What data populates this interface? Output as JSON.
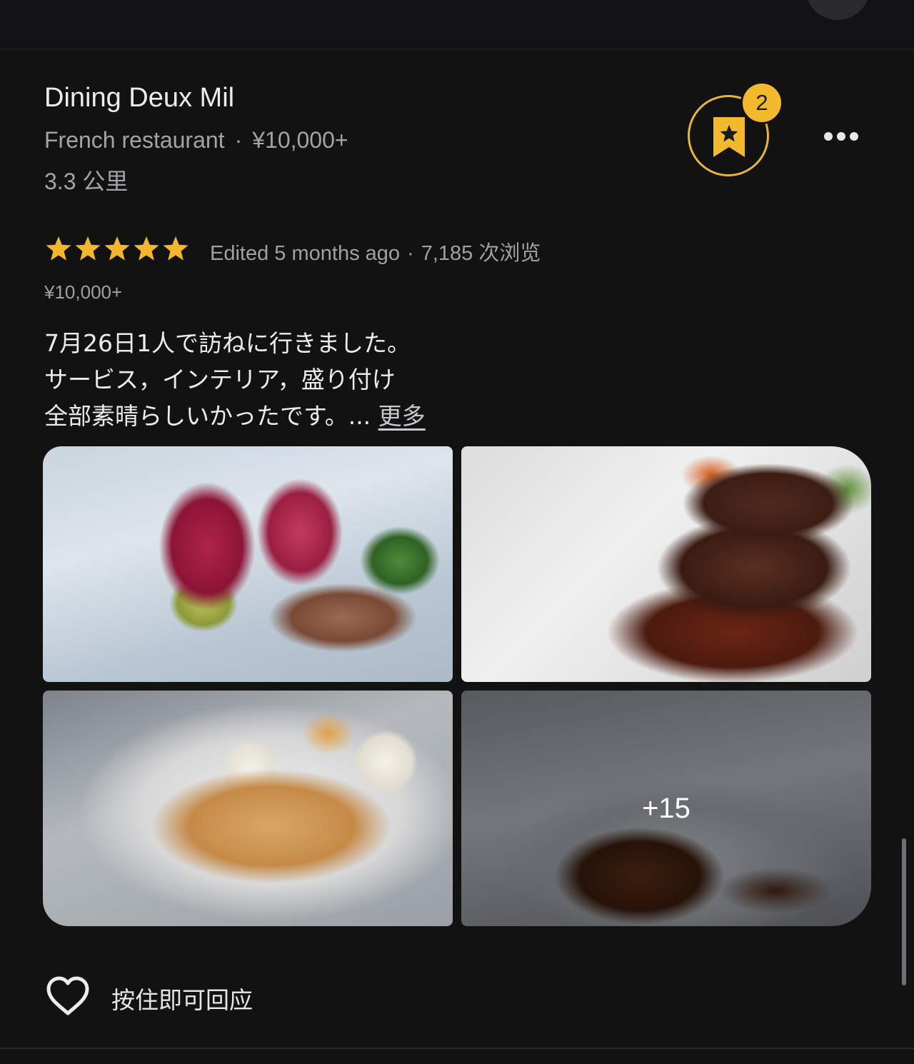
{
  "place": {
    "name": "Dining Deux Mil",
    "category": "French restaurant",
    "separator": "·",
    "price_range": "¥10,000+",
    "distance": "3.3 公里",
    "saved_count": "2"
  },
  "review": {
    "rating": 5,
    "edited": "Edited 5 months ago",
    "separator": "·",
    "views": "7,185 次浏览",
    "price": "¥10,000+",
    "text_lines": [
      "7月26日1人で訪ねに行きました。",
      "サービス，インテリア，盛り付け",
      "全部素晴らしいかったです。... "
    ],
    "more_label": "更多",
    "extra_photos": "+15"
  },
  "react": {
    "label": "按住即可回应"
  },
  "colors": {
    "background": "#121213",
    "accent_gold": "#f2b92e",
    "star": "#f3b62f",
    "muted_text": "#a3a3a8"
  },
  "icons": {
    "save": "bookmark-star-icon",
    "more": "more-horizontal-icon",
    "react": "heart-outline-icon"
  }
}
